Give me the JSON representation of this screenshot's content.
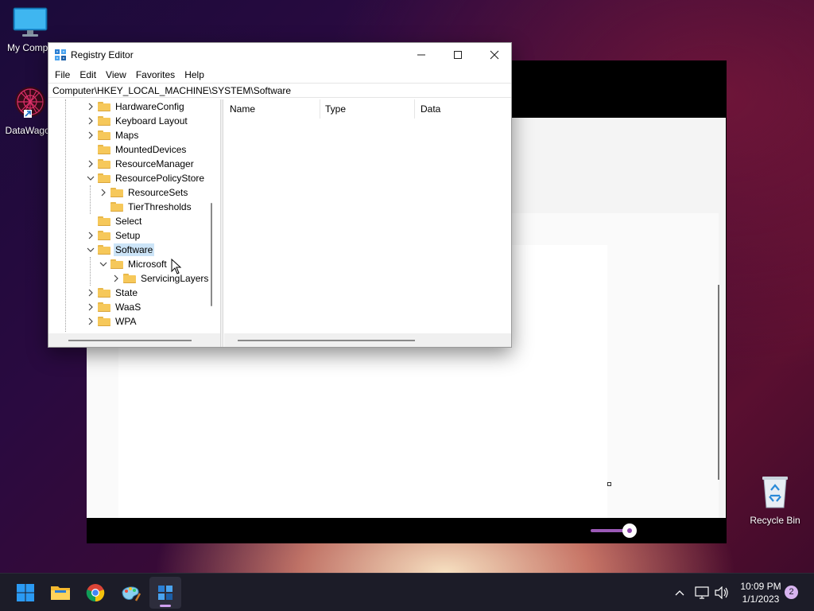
{
  "desktop": {
    "icons": [
      {
        "label": "My Compu",
        "icon": "monitor-icon"
      },
      {
        "label": "DataWagon",
        "icon": "datawagon-app-icon"
      },
      {
        "label": "Recycle Bin",
        "icon": "recycle-bin-icon"
      }
    ]
  },
  "registry_editor": {
    "title": "Registry Editor",
    "controls": {
      "minimize": "—",
      "maximize": "☐",
      "close": "✕"
    },
    "menu": [
      "File",
      "Edit",
      "View",
      "Favorites",
      "Help"
    ],
    "address": "Computer\\HKEY_LOCAL_MACHINE\\SYSTEM\\Software",
    "tree": [
      {
        "label": "HardwareConfig",
        "level": 0,
        "expander": "collapsed",
        "selected": false
      },
      {
        "label": "Keyboard Layout",
        "level": 0,
        "expander": "collapsed",
        "selected": false
      },
      {
        "label": "Maps",
        "level": 0,
        "expander": "collapsed",
        "selected": false
      },
      {
        "label": "MountedDevices",
        "level": 0,
        "expander": "none",
        "selected": false
      },
      {
        "label": "ResourceManager",
        "level": 0,
        "expander": "collapsed",
        "selected": false
      },
      {
        "label": "ResourcePolicyStore",
        "level": 0,
        "expander": "expanded",
        "selected": false
      },
      {
        "label": "ResourceSets",
        "level": 1,
        "expander": "collapsed",
        "selected": false
      },
      {
        "label": "TierThresholds",
        "level": 1,
        "expander": "none",
        "selected": false
      },
      {
        "label": "Select",
        "level": 0,
        "expander": "none",
        "selected": false
      },
      {
        "label": "Setup",
        "level": 0,
        "expander": "collapsed",
        "selected": false
      },
      {
        "label": "Software",
        "level": 0,
        "expander": "expanded",
        "selected": true
      },
      {
        "label": "Microsoft",
        "level": 1,
        "expander": "expanded",
        "selected": false
      },
      {
        "label": "ServicingLayers",
        "level": 2,
        "expander": "collapsed",
        "selected": false
      },
      {
        "label": "State",
        "level": 0,
        "expander": "collapsed",
        "selected": false
      },
      {
        "label": "WaaS",
        "level": 0,
        "expander": "collapsed",
        "selected": false
      },
      {
        "label": "WPA",
        "level": 0,
        "expander": "collapsed",
        "selected": false
      }
    ],
    "columns": [
      "Name",
      "Type",
      "Data"
    ]
  },
  "taskbar": {
    "apps": [
      {
        "name": "start-button",
        "icon": "windows-start-icon"
      },
      {
        "name": "file-explorer",
        "icon": "folder-icon"
      },
      {
        "name": "chrome",
        "icon": "chrome-icon"
      },
      {
        "name": "paint",
        "icon": "paint-icon"
      },
      {
        "name": "registry-editor",
        "icon": "registry-icon"
      }
    ],
    "time": "10:09 PM",
    "date": "1/1/2023",
    "notification_count": "2"
  },
  "colors": {
    "selection": "#cce4f7",
    "folder": "#f6c85a",
    "taskbar": "#1c1c28",
    "accent": "#8e44ad"
  }
}
